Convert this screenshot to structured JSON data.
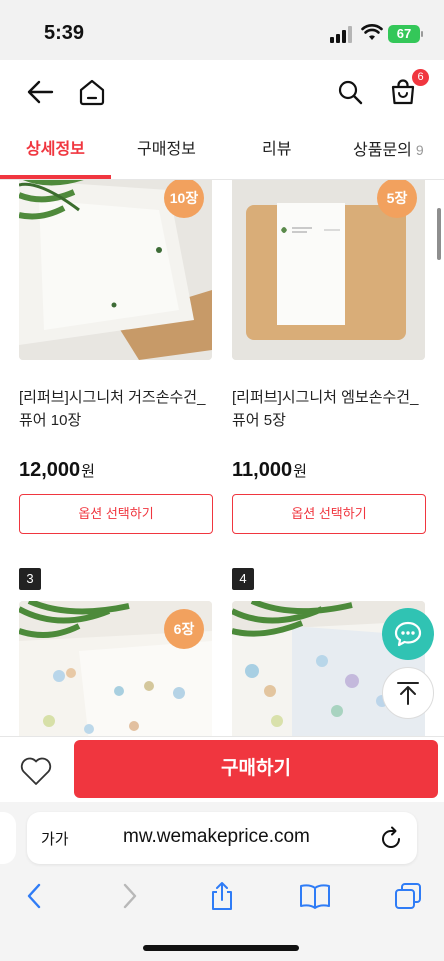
{
  "status_bar": {
    "time": "5:39",
    "battery": "67"
  },
  "header": {
    "back_icon": "arrow-left-icon",
    "home_icon": "home-icon",
    "search_icon": "search-icon",
    "cart_icon": "shopping-bag-icon",
    "cart_count": "6"
  },
  "tabs": [
    {
      "label": "상세정보",
      "active": true
    },
    {
      "label": "구매정보",
      "active": false
    },
    {
      "label": "리뷰",
      "active": false
    },
    {
      "label": "상품문의",
      "count": "9",
      "active": false
    }
  ],
  "products": [
    {
      "qty_badge": "10장",
      "name": "[리퍼브]시그니처 거즈손수건_퓨어 10장",
      "price": "12,000",
      "currency": "원",
      "option_label": "옵션 선택하기"
    },
    {
      "qty_badge": "5장",
      "name": "[리퍼브]시그니처 엠보손수건_퓨어 5장",
      "price": "11,000",
      "currency": "원",
      "option_label": "옵션 선택하기"
    },
    {
      "number": "3",
      "qty_badge": "6장"
    },
    {
      "number": "4"
    }
  ],
  "floating": {
    "chat_icon": "chat-bubble-icon",
    "top_icon": "arrow-up-to-top-icon"
  },
  "purchase_bar": {
    "wish_icon": "heart-icon",
    "buy_label": "구매하기"
  },
  "browser": {
    "aa_label": "가가",
    "url": "mw.wemakeprice.com"
  },
  "colors": {
    "accent": "#f0363f",
    "badge_orange": "#f2a15e",
    "chat_teal": "#30c3b3",
    "ios_blue": "#2f7cf6"
  }
}
